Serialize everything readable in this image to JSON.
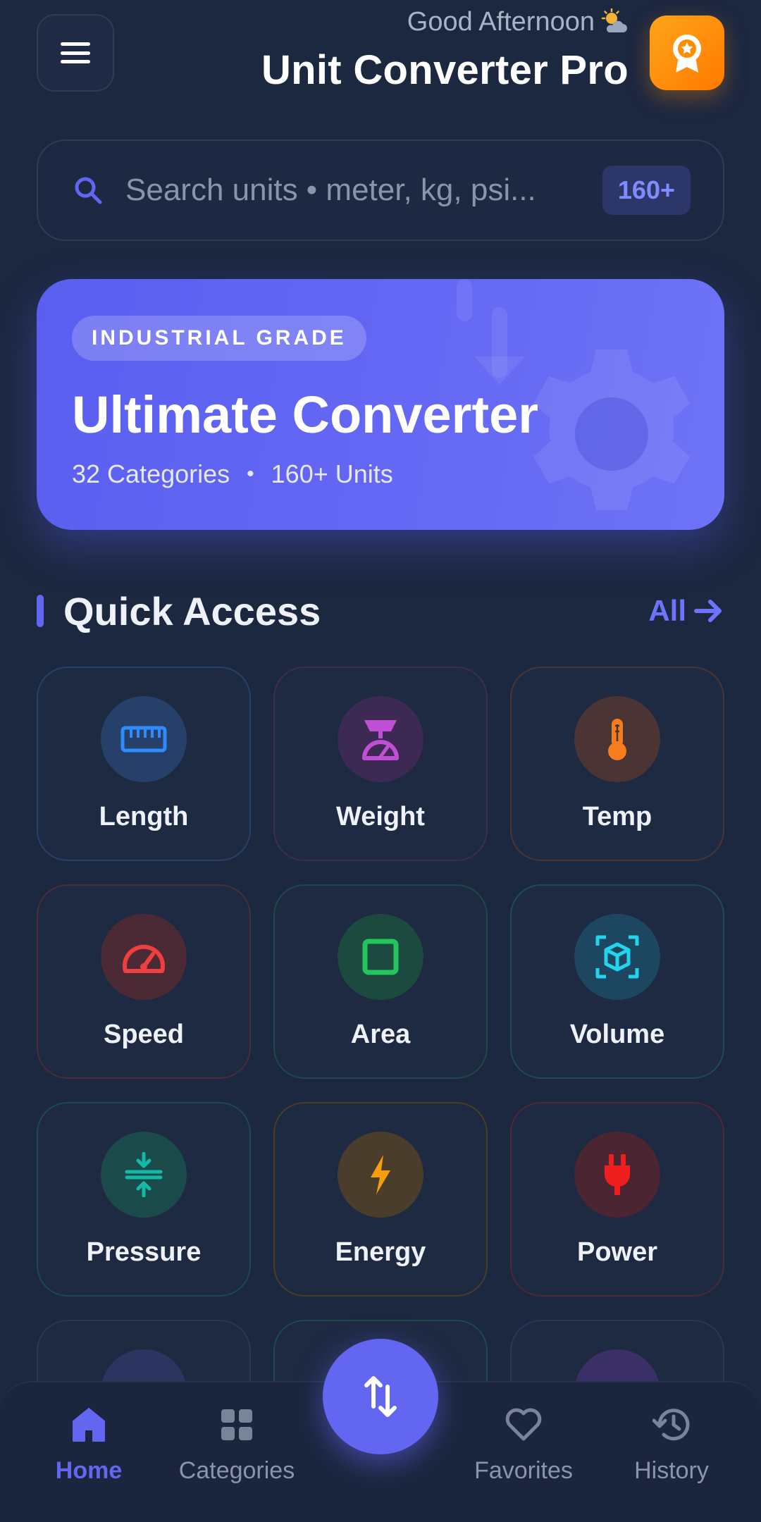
{
  "header": {
    "greeting": "Good Afternoon",
    "weather_icon": "sun-cloud-icon",
    "title": "Unit Converter Pro"
  },
  "search": {
    "placeholder": "Search units • meter, kg, psi...",
    "badge": "160+"
  },
  "banner": {
    "chip": "INDUSTRIAL GRADE",
    "title": "Ultimate Converter",
    "categories": "32 Categories",
    "units": "160+ Units"
  },
  "quick_access": {
    "title": "Quick Access",
    "all_label": "All",
    "tiles": [
      {
        "label": "Length",
        "icon": "ruler-icon",
        "color": "#2f8cff"
      },
      {
        "label": "Weight",
        "icon": "scale-icon",
        "color": "#c04fd6"
      },
      {
        "label": "Temp",
        "icon": "thermometer-icon",
        "color": "#f57c1f"
      },
      {
        "label": "Speed",
        "icon": "speedometer-icon",
        "color": "#ef3f3f"
      },
      {
        "label": "Area",
        "icon": "square-icon",
        "color": "#22c55e"
      },
      {
        "label": "Volume",
        "icon": "cube-icon",
        "color": "#22d3ee"
      },
      {
        "label": "Pressure",
        "icon": "compress-icon",
        "color": "#14b8a6"
      },
      {
        "label": "Energy",
        "icon": "bolt-icon",
        "color": "#f59e0b"
      },
      {
        "label": "Power",
        "icon": "plug-icon",
        "color": "#ef1f1f"
      }
    ]
  },
  "nav": {
    "items": [
      {
        "label": "Home",
        "icon": "home-icon"
      },
      {
        "label": "Categories",
        "icon": "grid-icon"
      },
      {
        "label": "Favorites",
        "icon": "heart-icon"
      },
      {
        "label": "History",
        "icon": "history-icon"
      }
    ],
    "fab_icon": "swap-arrows-icon"
  },
  "colors": {
    "background": "#1c2740",
    "accent": "#6366f1",
    "award": "#ff8c00"
  }
}
